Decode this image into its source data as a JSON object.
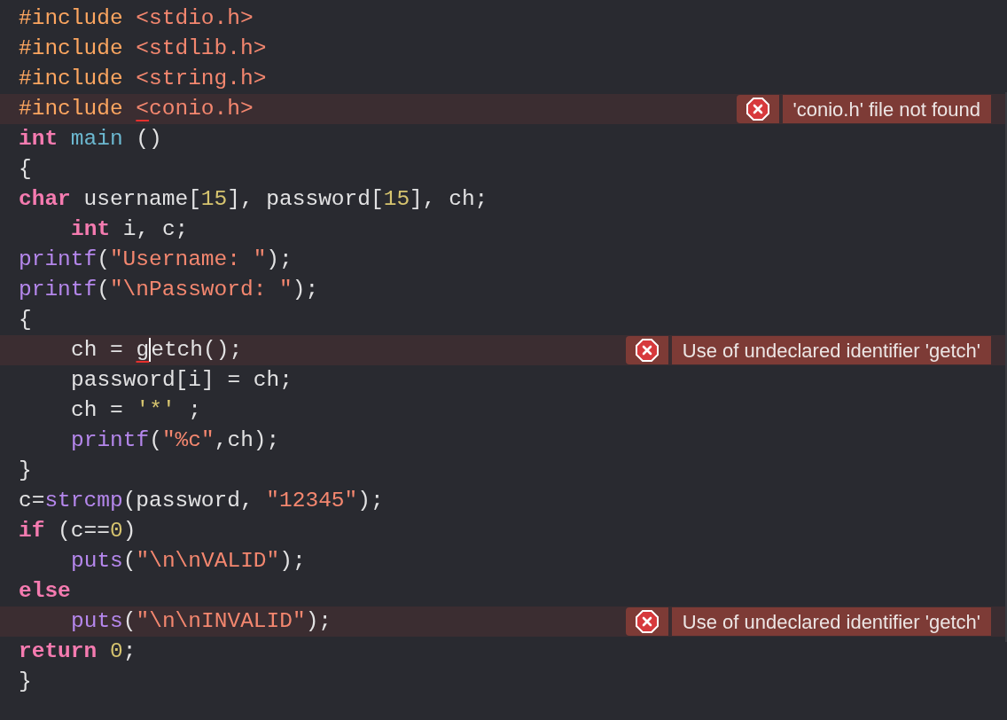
{
  "editor": {
    "lines": [
      {
        "indented": false,
        "tokens": [
          {
            "text": "#include ",
            "kind": "preprocessor"
          },
          {
            "text": "<stdio.h>",
            "kind": "include-path"
          }
        ]
      },
      {
        "indented": false,
        "tokens": [
          {
            "text": "#include ",
            "kind": "preprocessor"
          },
          {
            "text": "<stdlib.h>",
            "kind": "include-path"
          }
        ]
      },
      {
        "indented": false,
        "tokens": [
          {
            "text": "#include ",
            "kind": "preprocessor"
          },
          {
            "text": "<string.h>",
            "kind": "include-path"
          }
        ]
      },
      {
        "indented": false,
        "error": "'conio.h' file not found",
        "tokens": [
          {
            "text": "#include ",
            "kind": "preprocessor"
          },
          {
            "text": "<",
            "kind": "include-path",
            "flagged": true
          },
          {
            "text": "conio.h>",
            "kind": "include-path"
          }
        ]
      },
      {
        "indented": false,
        "tokens": [
          {
            "text": "int ",
            "kind": "keyword"
          },
          {
            "text": "main",
            "kind": "declaration"
          },
          {
            "text": " ()",
            "kind": "plain"
          }
        ]
      },
      {
        "indented": false,
        "tokens": [
          {
            "text": "{",
            "kind": "plain"
          }
        ]
      },
      {
        "indented": false,
        "tokens": [
          {
            "text": "char",
            "kind": "keyword"
          },
          {
            "text": " username[",
            "kind": "plain"
          },
          {
            "text": "15",
            "kind": "number"
          },
          {
            "text": "], password[",
            "kind": "plain"
          },
          {
            "text": "15",
            "kind": "number"
          },
          {
            "text": "], ch;",
            "kind": "plain"
          }
        ]
      },
      {
        "indented": true,
        "tokens": [
          {
            "text": "int",
            "kind": "keyword"
          },
          {
            "text": " i, c;",
            "kind": "plain"
          }
        ]
      },
      {
        "indented": false,
        "tokens": [
          {
            "text": "printf",
            "kind": "call"
          },
          {
            "text": "(",
            "kind": "plain"
          },
          {
            "text": "\"Username: \"",
            "kind": "string"
          },
          {
            "text": ");",
            "kind": "plain"
          }
        ]
      },
      {
        "indented": false,
        "tokens": [
          {
            "text": "printf",
            "kind": "call"
          },
          {
            "text": "(",
            "kind": "plain"
          },
          {
            "text": "\"\\nPassword: \"",
            "kind": "string"
          },
          {
            "text": ");",
            "kind": "plain"
          }
        ]
      },
      {
        "indented": false,
        "tokens": [
          {
            "text": "{",
            "kind": "plain"
          }
        ]
      },
      {
        "indented": true,
        "error": "Use of undeclared identifier 'getch'",
        "tokens": [
          {
            "text": "ch = ",
            "kind": "plain"
          },
          {
            "text": "g",
            "kind": "plain",
            "flagged": true,
            "caret": true
          },
          {
            "text": "etch();",
            "kind": "plain"
          }
        ]
      },
      {
        "indented": true,
        "tokens": [
          {
            "text": "password[i] = ch;",
            "kind": "plain"
          }
        ]
      },
      {
        "indented": true,
        "tokens": [
          {
            "text": "ch = ",
            "kind": "plain"
          },
          {
            "text": "'*'",
            "kind": "character"
          },
          {
            "text": " ;",
            "kind": "plain"
          }
        ]
      },
      {
        "indented": true,
        "tokens": [
          {
            "text": "printf",
            "kind": "call"
          },
          {
            "text": "(",
            "kind": "plain"
          },
          {
            "text": "\"%c\"",
            "kind": "string"
          },
          {
            "text": ",ch);",
            "kind": "plain"
          }
        ]
      },
      {
        "indented": false,
        "tokens": [
          {
            "text": "}",
            "kind": "plain"
          }
        ]
      },
      {
        "indented": false,
        "tokens": [
          {
            "text": "c=",
            "kind": "plain"
          },
          {
            "text": "strcmp",
            "kind": "call"
          },
          {
            "text": "(password, ",
            "kind": "plain"
          },
          {
            "text": "\"12345\"",
            "kind": "string"
          },
          {
            "text": ");",
            "kind": "plain"
          }
        ]
      },
      {
        "indented": false,
        "tokens": [
          {
            "text": "if",
            "kind": "keyword"
          },
          {
            "text": " (c==",
            "kind": "plain"
          },
          {
            "text": "0",
            "kind": "number"
          },
          {
            "text": ")",
            "kind": "plain"
          }
        ]
      },
      {
        "indented": true,
        "tokens": [
          {
            "text": "puts",
            "kind": "call"
          },
          {
            "text": "(",
            "kind": "plain"
          },
          {
            "text": "\"\\n\\nVALID\"",
            "kind": "string"
          },
          {
            "text": ");",
            "kind": "plain"
          }
        ]
      },
      {
        "indented": false,
        "tokens": [
          {
            "text": "else",
            "kind": "keyword"
          }
        ]
      },
      {
        "indented": true,
        "error": "Use of undeclared identifier 'getch'",
        "tokens": [
          {
            "text": "puts",
            "kind": "call"
          },
          {
            "text": "(",
            "kind": "plain"
          },
          {
            "text": "\"\\n\\nINVALID\"",
            "kind": "string"
          },
          {
            "text": ");",
            "kind": "plain"
          }
        ]
      },
      {
        "indented": false,
        "tokens": [
          {
            "text": "return ",
            "kind": "keyword"
          },
          {
            "text": "0",
            "kind": "number"
          },
          {
            "text": ";",
            "kind": "plain"
          }
        ]
      },
      {
        "indented": false,
        "tokens": [
          {
            "text": "}",
            "kind": "plain"
          }
        ]
      }
    ]
  }
}
